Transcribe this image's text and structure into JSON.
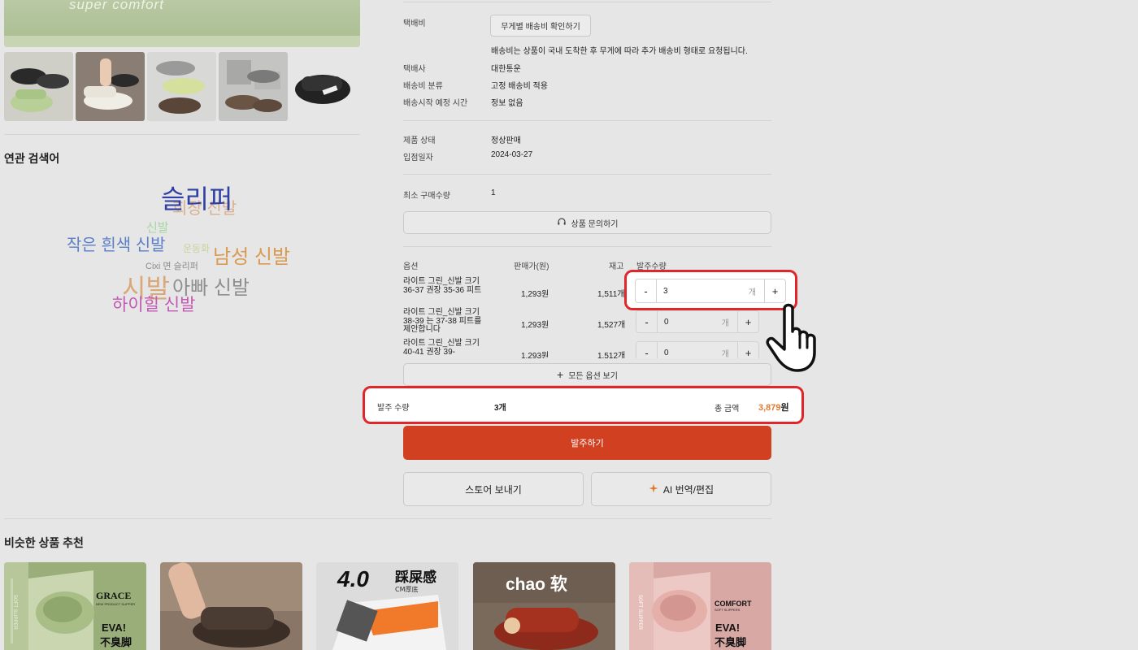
{
  "gallery": {
    "main_brand_text": "super comfort",
    "thumbnails": [
      "thumb-1",
      "thumb-2",
      "thumb-3",
      "thumb-4",
      "thumb-5"
    ]
  },
  "related": {
    "title": "연관 검색어",
    "words": [
      {
        "text": "회장 신발",
        "color": "#d9b08f"
      },
      {
        "text": "슬리퍼",
        "color": "#2f3fa3"
      },
      {
        "text": "신발",
        "color": "#a6d6a0"
      },
      {
        "text": "작은 흰색 신발",
        "color": "#5a7fc8"
      },
      {
        "text": "운동화",
        "color": "#c9d49a"
      },
      {
        "text": "남성 신발",
        "color": "#d99a52"
      },
      {
        "text": "Cixi 면 슬리퍼",
        "color": "#8a8a8a"
      },
      {
        "text": "시발",
        "color": "#d9a87a"
      },
      {
        "text": "아빠 신발",
        "color": "#8f8f8f"
      },
      {
        "text": "하이힐 신발",
        "color": "#c459b5"
      }
    ]
  },
  "shipping": {
    "fee_label": "택배비",
    "fee_button": "무게별 배송비 확인하기",
    "fee_note": "배송비는 상품이 국내 도착한 후 무게에 따라 추가 배송비 형태로 요청됩니다.",
    "courier_label": "택배사",
    "courier_value": "대한통운",
    "fee_type_label": "배송비 분류",
    "fee_type_value": "고정 배송비 적용",
    "start_label": "배송시작 예정 시간",
    "start_value": "정보 없음"
  },
  "product": {
    "status_label": "제품 상태",
    "status_value": "정상판매",
    "date_label": "입점일자",
    "date_value": "2024-03-27",
    "min_qty_label": "최소 구매수량",
    "min_qty_value": "1",
    "inquiry_button": "상품 문의하기"
  },
  "options": {
    "headers": {
      "option": "옵션",
      "price": "판매가(원)",
      "stock": "재고",
      "qty": "발주수량"
    },
    "unit": "개",
    "minus": "-",
    "plus": "+",
    "rows": [
      {
        "name": "라이트 그린_신발 크기 36-37 권장 35-36 피트",
        "price": "1,293원",
        "stock": "1,511개",
        "qty": "3"
      },
      {
        "name": "라이트 그린_신발 크기 38-39 는 37-38 피트를 제안합니다",
        "price": "1,293원",
        "stock": "1,527개",
        "qty": "0"
      },
      {
        "name": "라이트 그린_신발 크기 40-41 권장 39-",
        "price": "1,293원",
        "stock": "1,512개",
        "qty": "0"
      }
    ],
    "view_all": "모든 옵션 보기"
  },
  "summary": {
    "qty_label": "발주 수량",
    "qty_value": "3개",
    "total_label": "총 금액",
    "total_value": "3,879",
    "total_unit": "원",
    "accent_color": "#e07a2e"
  },
  "actions": {
    "order": "발주하기",
    "send_store": "스토어 보내기",
    "ai_translate": "AI 번역/편집"
  },
  "similar": {
    "title": "비슷한 상품 추천",
    "items": [
      {
        "brand": "GRACE",
        "sub": "NEW PRODUCT SLIPPER",
        "line1": "EVA!",
        "line2": "不臭脚",
        "side": "SOFT SLIPPER"
      },
      {
        "brand": "",
        "sub": "",
        "line1": "",
        "line2": "",
        "side": ""
      },
      {
        "brand": "4.0",
        "sub": "CM厚底",
        "line1": "踩屎感",
        "line2": "",
        "side": ""
      },
      {
        "brand": "chao 软",
        "sub": "",
        "line1": "",
        "line2": "",
        "side": ""
      },
      {
        "brand": "COMFORT",
        "sub": "SOFT SLIPPERS",
        "line1": "EVA!",
        "line2": "不臭脚",
        "side": "SOFT SLIPPER"
      }
    ]
  },
  "colors": {
    "primary": "#d24022",
    "highlight": "#e0262a"
  }
}
